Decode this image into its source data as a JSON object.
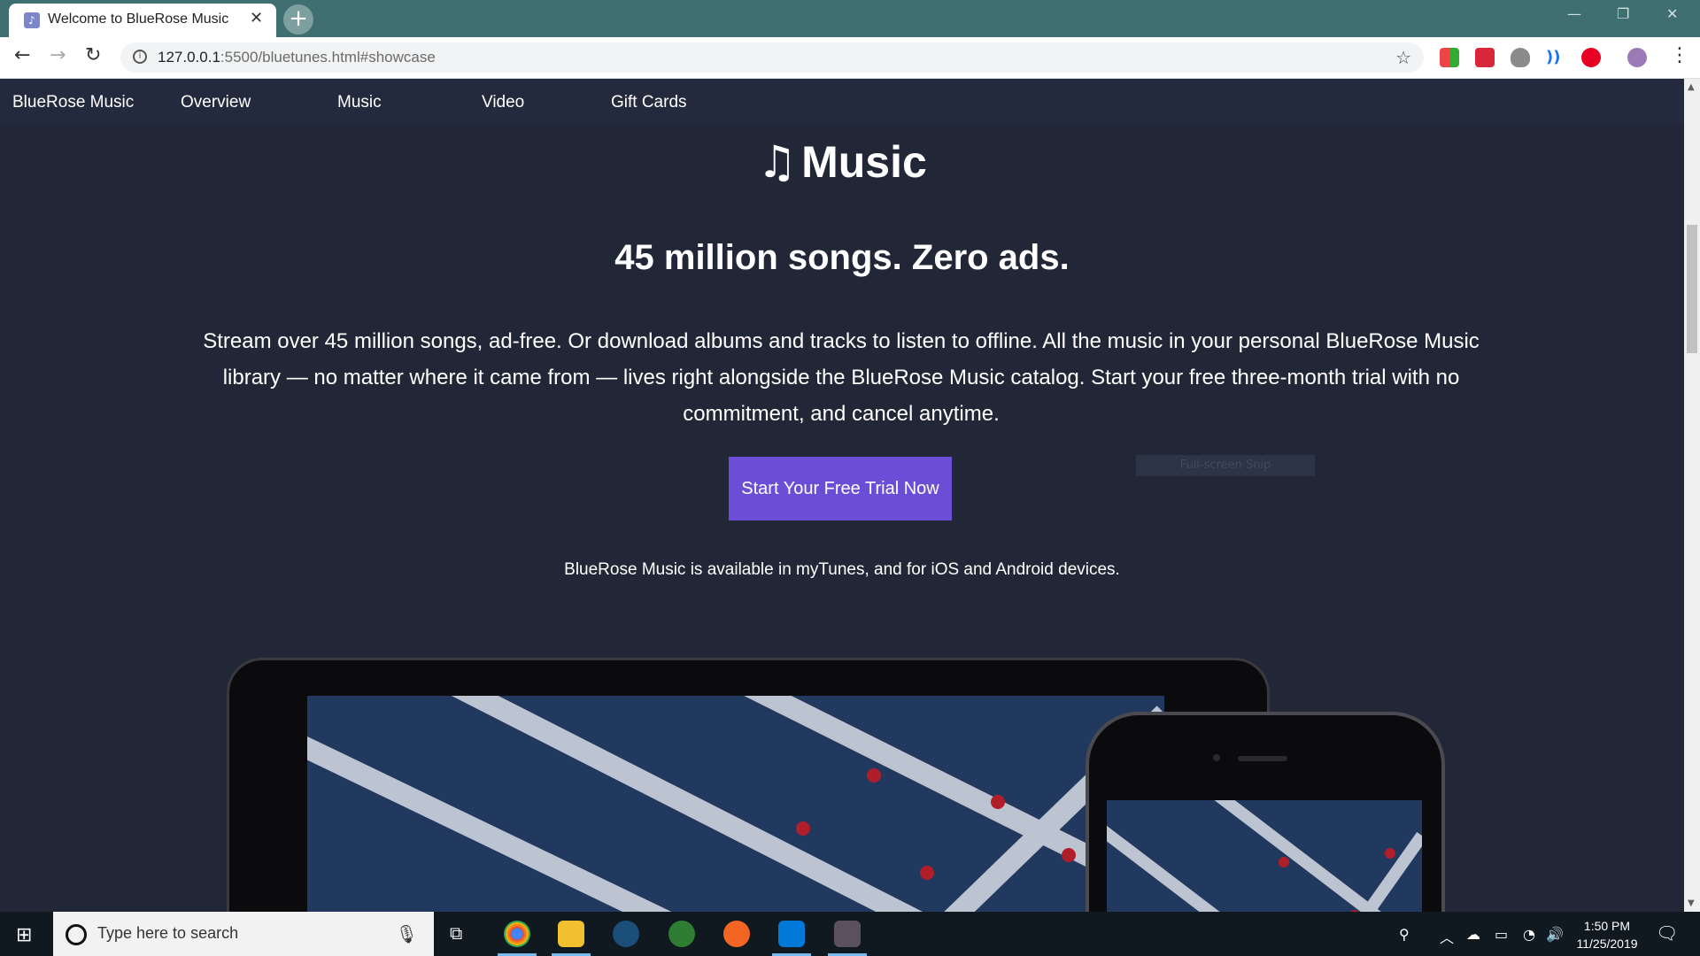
{
  "browser": {
    "tab_title": "Welcome to BlueRose Music",
    "url_host": "127.0.0.1",
    "url_path": ":5500/bluetunes.html#showcase"
  },
  "site": {
    "nav": [
      "BlueRose Music",
      "Overview",
      "Music",
      "Video",
      "Gift Cards"
    ],
    "logo_word": "Music",
    "headline": "45 million songs. Zero ads.",
    "paragraph": "Stream over 45 million songs, ad-free. Or download albums and tracks to listen to offline. All the music in your personal BlueRose Music library — no matter where it came from — lives right alongside the BlueRose Music catalog. Start your free three-month trial with no commitment, and cancel anytime.",
    "cta_label": "Start Your Free Trial Now",
    "snip_overlay": "Full-screen Snip",
    "availability": "BlueRose Music is available in myTunes, and for iOS and Android devices."
  },
  "taskbar": {
    "search_placeholder": "Type here to search",
    "time": "1:50 PM",
    "date": "11/25/2019"
  },
  "colors": {
    "page_bg": "#222737",
    "cta_bg": "#6a4fd6",
    "tabstrip": "#3f6f71"
  }
}
